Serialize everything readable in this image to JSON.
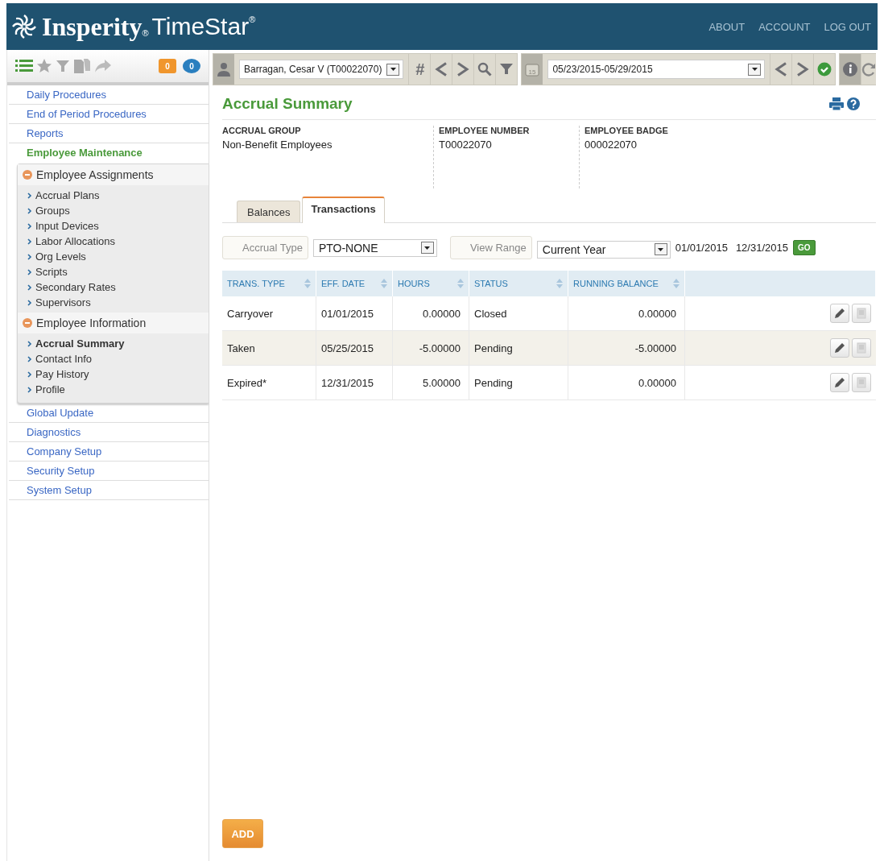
{
  "header": {
    "logo": {
      "name": "Insperity",
      "name_mark": "®",
      "product": "TimeStar",
      "product_mark": "®"
    },
    "links": [
      "ABOUT",
      "ACCOUNT",
      "LOG OUT"
    ]
  },
  "sidebar": {
    "badges": [
      {
        "kind": "note",
        "count": "0",
        "color": "#f0962d"
      },
      {
        "kind": "chat",
        "count": "0",
        "color": "#2a7fbf"
      }
    ],
    "items": [
      {
        "label": "Daily Procedures",
        "selected": false
      },
      {
        "label": "End of Period Procedures",
        "selected": false
      },
      {
        "label": "Reports",
        "selected": false
      },
      {
        "label": "Employee Maintenance",
        "selected": true,
        "children": [
          {
            "label": "Employee Assignments",
            "expanded": true,
            "children": [
              {
                "label": "Accrual Plans",
                "selected": false
              },
              {
                "label": "Groups",
                "selected": false
              },
              {
                "label": "Input Devices",
                "selected": false
              },
              {
                "label": "Labor Allocations",
                "selected": false
              },
              {
                "label": "Org Levels",
                "selected": false
              },
              {
                "label": "Scripts",
                "selected": false
              },
              {
                "label": "Secondary Rates",
                "selected": false
              },
              {
                "label": "Supervisors",
                "selected": false
              }
            ]
          },
          {
            "label": "Employee Information",
            "expanded": true,
            "children": [
              {
                "label": "Accrual Summary",
                "selected": true
              },
              {
                "label": "Contact Info",
                "selected": false
              },
              {
                "label": "Pay History",
                "selected": false
              },
              {
                "label": "Profile",
                "selected": false
              }
            ]
          }
        ]
      },
      {
        "label": "Global Update",
        "selected": false
      },
      {
        "label": "Diagnostics",
        "selected": false
      },
      {
        "label": "Company Setup",
        "selected": false
      },
      {
        "label": "Security Setup",
        "selected": false
      },
      {
        "label": "System Setup",
        "selected": false
      }
    ]
  },
  "toolbar": {
    "employee": "Barragan, Cesar V (T00022070)",
    "hash": "#",
    "date_range": "05/23/2015-05/29/2015",
    "calendar_day": "15"
  },
  "page": {
    "title": "Accrual Summary",
    "info": [
      {
        "label": "ACCRUAL GROUP",
        "value": "Non-Benefit Employees"
      },
      {
        "label": "EMPLOYEE NUMBER",
        "value": "T00022070"
      },
      {
        "label": "EMPLOYEE BADGE",
        "value": "000022070"
      }
    ],
    "tabs": [
      {
        "label": "Balances",
        "selected": false
      },
      {
        "label": "Transactions",
        "selected": true
      }
    ],
    "filters": {
      "accrual_type_label": "Accrual Type",
      "accrual_type": "PTO-NONE",
      "view_range_label": "View Range",
      "view_range": "Current Year",
      "start": "01/01/2015",
      "end": "12/31/2015",
      "go": "GO"
    },
    "table": {
      "columns": [
        "TRANS. TYPE",
        "EFF. DATE",
        "HOURS",
        "STATUS",
        "RUNNING BALANCE"
      ],
      "rows": [
        {
          "cells": [
            "Carryover",
            "01/01/2015",
            "0.00000",
            "Closed",
            "0.00000"
          ]
        },
        {
          "cells": [
            "Taken",
            "05/25/2015",
            "-5.00000",
            "Pending",
            "-5.00000"
          ]
        },
        {
          "cells": [
            "Expired*",
            "12/31/2015",
            "5.00000",
            "Pending",
            "0.00000"
          ]
        }
      ]
    },
    "add_button": "ADD"
  }
}
